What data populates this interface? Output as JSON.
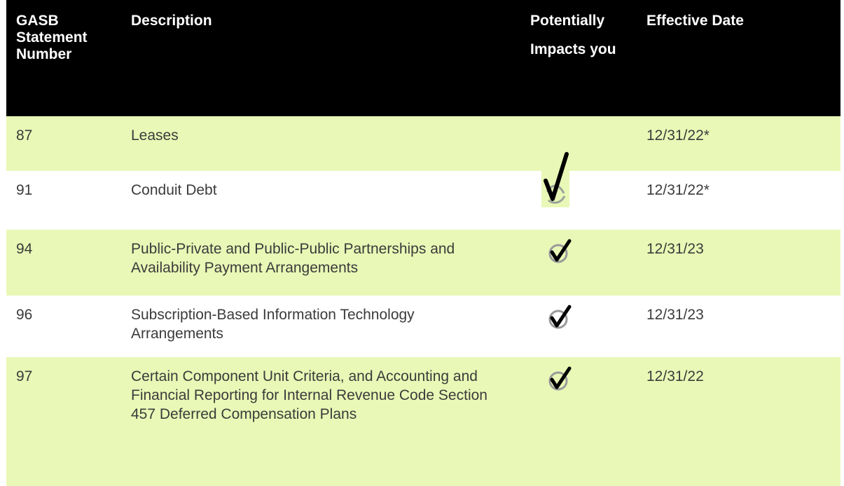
{
  "table": {
    "headers": {
      "number": "GASB Statement Number",
      "description": "Description",
      "impacts_line1": "Potentially",
      "impacts_line2": "Impacts you",
      "effective": "Effective Date"
    },
    "rows": [
      {
        "number": "87",
        "description": "Leases",
        "effective": "12/31/22*",
        "impacts": true
      },
      {
        "number": "91",
        "description": "Conduit Debt",
        "effective": "12/31/22*",
        "impacts": true
      },
      {
        "number": "94",
        "description": "Public-Private and Public-Public Partnerships and Availability Payment Arrangements",
        "effective": "12/31/23",
        "impacts": true
      },
      {
        "number": "96",
        "description": "Subscription-Based Information Technology Arrangements",
        "effective": "12/31/23",
        "impacts": true
      },
      {
        "number": "97",
        "description": "Certain Component Unit Criteria, and Accounting and Financial Reporting for Internal Revenue Code Section 457 Deferred Compensation Plans",
        "effective": "12/31/22",
        "impacts": true
      }
    ]
  },
  "colors": {
    "header_bg": "#000000",
    "shaded_row": "#e9f8b6",
    "text": "#3b3b3b"
  },
  "icons": {
    "impact_marker": "check-mark-icon"
  }
}
